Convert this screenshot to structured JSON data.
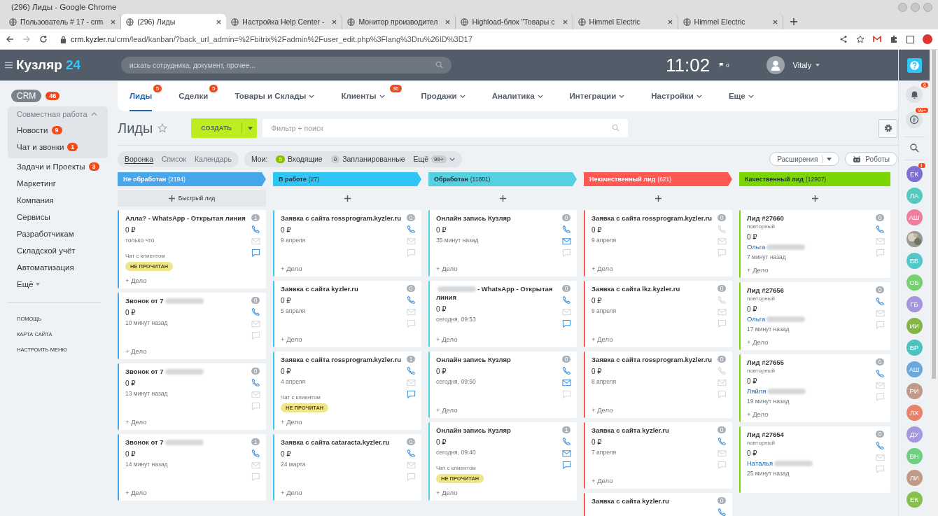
{
  "window": {
    "title": "(296) Лиды - Google Chrome"
  },
  "browser_tabs": [
    {
      "title": "Пользователь # 17 - crm",
      "selected": false
    },
    {
      "title": "(296) Лиды",
      "selected": true
    },
    {
      "title": "Настройка Help Center -",
      "selected": false
    },
    {
      "title": "Монитор производител",
      "selected": false
    },
    {
      "title": "Highload-блок \"Товары с",
      "selected": false
    },
    {
      "title": "Himmel Electric",
      "selected": false
    },
    {
      "title": "Himmel Electric",
      "selected": false
    }
  ],
  "address_bar": {
    "host": "crm.kyzler.ru",
    "path": "/crm/lead/kanban/?back_url_admin=%2Fbitrix%2Fadmin%2Fuser_edit.php%3Flang%3Dru%26ID%3D17"
  },
  "header": {
    "logo": "Кузляр",
    "logo_suffix": "24",
    "search": {
      "placeholder": "искать сотрудника, документ, прочее..."
    },
    "clock": "11:02",
    "flag_count": "0",
    "user": "Vitaly"
  },
  "sidebar": {
    "crm": {
      "label": "CRM",
      "badge": "46"
    },
    "group": {
      "label": "Совместная работа",
      "expanded": true,
      "items": [
        {
          "label": "Новости",
          "badge": "9"
        },
        {
          "label": "Чат и звонки",
          "badge": "1"
        }
      ]
    },
    "items": [
      {
        "label": "Задачи и Проекты",
        "badge": "3"
      },
      {
        "label": "Маркетинг"
      },
      {
        "label": "Компания"
      },
      {
        "label": "Сервисы"
      },
      {
        "label": "Разработчикам"
      },
      {
        "label": "Складской учёт"
      },
      {
        "label": "Автоматизация"
      },
      {
        "label": "Ещё",
        "dropdown": true
      }
    ],
    "links": [
      "ПОМОЩЬ",
      "КАРТА САЙТА",
      "НАСТРОИТЬ МЕНЮ"
    ]
  },
  "nav": [
    {
      "label": "Лиды",
      "badge": "5",
      "dropdown": false,
      "selected": true
    },
    {
      "label": "Сделки",
      "badge": "5",
      "dropdown": false,
      "selected": false
    },
    {
      "label": "Товары и Склады",
      "dropdown": true,
      "selected": false
    },
    {
      "label": "Клиенты",
      "badge": "36",
      "dropdown": true,
      "selected": false
    },
    {
      "label": "Продажи",
      "dropdown": true,
      "selected": false
    },
    {
      "label": "Аналитика",
      "dropdown": true,
      "selected": false
    },
    {
      "label": "Интеграции",
      "dropdown": true,
      "selected": false
    },
    {
      "label": "Настройки",
      "dropdown": true,
      "selected": false
    },
    {
      "label": "Еще",
      "dropdown": true,
      "selected": false
    }
  ],
  "page": {
    "title": "Лиды",
    "create_button": "СОЗДАТЬ",
    "filter": {
      "placeholder": "Фильтр + поиск"
    }
  },
  "toolbar": {
    "views": [
      {
        "label": "Воронка",
        "selected": true
      },
      {
        "label": "Список",
        "selected": false
      },
      {
        "label": "Календарь",
        "selected": false
      }
    ],
    "my_label": "Мои:",
    "counters": [
      {
        "count": "5",
        "label": "Входящие",
        "active": true
      },
      {
        "count": "0",
        "label": "Запланированные",
        "active": false
      }
    ],
    "more": {
      "label": "Ещё",
      "badge": "99+"
    },
    "extensions": "Расширения",
    "robots": "Роботы"
  },
  "columns": [
    {
      "name": "Не обработан",
      "count": "(2194)",
      "color": "#47a7ea",
      "quick_add": "Быстрый лид",
      "cards": [
        {
          "title": "Алла? - WhatsApp - Открытая линия",
          "count": "1",
          "amount": "0 ₽",
          "time": "только что",
          "chat_label": "Чат с клиентом",
          "badge": "НЕ ПРОЧИТАН",
          "phone_active": true,
          "mail_active": false,
          "chat_active": true,
          "add": "+ Дело"
        },
        {
          "title": "Звонок от 7",
          "blurred_suffix": true,
          "count": "0",
          "amount": "0 ₽",
          "time": "10 минут назад",
          "phone_active": true,
          "mail_active": false,
          "chat_active": false,
          "add": "+ Дело"
        },
        {
          "title": "Звонок от 7",
          "blurred_suffix": true,
          "count": "0",
          "amount": "0 ₽",
          "time": "13 минут назад",
          "phone_active": true,
          "mail_active": false,
          "chat_active": false,
          "add": "+ Дело"
        },
        {
          "title": "Звонок от 7",
          "blurred_suffix": true,
          "count": "1",
          "amount": "0 ₽",
          "time": "14 минут назад",
          "phone_active": true,
          "mail_active": false,
          "chat_active": false,
          "add": "+ Дело"
        }
      ]
    },
    {
      "name": "В работе",
      "count": "(27)",
      "color": "#2fc6f6",
      "cards": [
        {
          "title": "Заявка с сайта rossprogram.kyzler.ru",
          "count": "0",
          "amount": "0 ₽",
          "time": "9 апреля",
          "phone_active": true,
          "mail_active": false,
          "chat_active": false,
          "add": "+ Дело"
        },
        {
          "title": "Заявка с сайта kyzler.ru",
          "count": "0",
          "amount": "0 ₽",
          "time": "5 апреля",
          "phone_active": true,
          "mail_active": false,
          "chat_active": false,
          "add": "+ Дело"
        },
        {
          "title": "Заявка с сайта rossprogram.kyzler.ru",
          "count": "1",
          "amount": "0 ₽",
          "time": "4 апреля",
          "chat_label": "Чат с клиентом",
          "badge": "НЕ ПРОЧИТАН",
          "phone_active": true,
          "mail_active": false,
          "chat_active": true,
          "add": "+ Дело"
        },
        {
          "title": "Заявка с сайта cataracta.kyzler.ru",
          "count": "0",
          "amount": "0 ₽",
          "time": "24 марта",
          "phone_active": true,
          "mail_active": false,
          "chat_active": false,
          "add": "+ Дело"
        }
      ]
    },
    {
      "name": "Обработан",
      "count": "(11801)",
      "color": "#55d0e0",
      "cards": [
        {
          "title": "Онлайн запись Кузляр",
          "count": "0",
          "amount": "0 ₽",
          "time": "35 минут назад",
          "phone_active": true,
          "mail_active": true,
          "chat_active": false,
          "add": "+ Дело"
        },
        {
          "title": "- WhatsApp - Открытая линия",
          "blurred_prefix": true,
          "count": "0",
          "amount": "0 ₽",
          "time": "сегодня, 09:53",
          "phone_active": true,
          "mail_active": false,
          "chat_active": true,
          "add": "+ Дело"
        },
        {
          "title": "Онлайн запись Кузляр",
          "count": "0",
          "amount": "0 ₽",
          "time": "сегодня, 09:50",
          "phone_active": true,
          "mail_active": true,
          "chat_active": false,
          "add": "+ Дело"
        },
        {
          "title": "Онлайн запись Кузляр",
          "count": "1",
          "amount": "0 ₽",
          "time": "сегодня, 09:40",
          "chat_label": "Чат с клиентом",
          "badge": "НЕ ПРОЧИТАН",
          "phone_active": true,
          "mail_active": true,
          "chat_active": true,
          "add": "+ Дело"
        }
      ]
    },
    {
      "name": "Некачественный лид",
      "count": "(621)",
      "color": "#ff5752",
      "cards": [
        {
          "title": "Заявка с сайта rossprogram.kyzler.ru",
          "count": "0",
          "amount": "0 ₽",
          "time": "9 апреля",
          "phone_active": false,
          "mail_active": false,
          "chat_active": false,
          "add": "+ Дело"
        },
        {
          "title": "Заявка с сайта lkz.kyzler.ru",
          "count": "0",
          "amount": "0 ₽",
          "time": "9 апреля",
          "phone_active": false,
          "mail_active": false,
          "chat_active": false,
          "add": "+ Дело"
        },
        {
          "title": "Заявка с сайта rossprogram.kyzler.ru",
          "count": "0",
          "amount": "0 ₽",
          "time": "8 апреля",
          "phone_active": false,
          "mail_active": false,
          "chat_active": false,
          "add": "+ Дело"
        },
        {
          "title": "Заявка с сайта kyzler.ru",
          "count": "0",
          "amount": "0 ₽",
          "time": "7 апреля",
          "phone_active": true,
          "mail_active": false,
          "chat_active": false,
          "add": "+ Дело"
        },
        {
          "title": "Заявка с сайта kyzler.ru",
          "count": "0",
          "phone_active": true
        }
      ]
    },
    {
      "name": "Качественный лид",
      "count": "(12907)",
      "color": "#7bd500",
      "cards": [
        {
          "title": "Лид #27660",
          "subtitle": "повторный",
          "count": "0",
          "amount": "0 ₽",
          "contact": "Ольга",
          "time": "7 минут назад",
          "phone_active": true,
          "mail_active": false,
          "chat_active": false,
          "add": "+ Дело"
        },
        {
          "title": "Лид #27656",
          "subtitle": "повторный",
          "count": "0",
          "amount": "0 ₽",
          "contact": "Ольга",
          "time": "17 минут назад",
          "phone_active": true,
          "mail_active": false,
          "chat_active": false,
          "add": "+ Дело"
        },
        {
          "title": "Лид #27655",
          "subtitle": "повторный",
          "count": "0",
          "amount": "0 ₽",
          "contact": "Ляйля",
          "time": "19 минут назад",
          "phone_active": true,
          "mail_active": false,
          "chat_active": false,
          "add": "+ Дело"
        },
        {
          "title": "Лид #27654",
          "subtitle": "повторный",
          "count": "0",
          "amount": "0 ₽",
          "contact": "Наталья",
          "time": "25 минут назад",
          "phone_active": true,
          "mail_active": false,
          "chat_active": false
        }
      ]
    }
  ],
  "right_panel": {
    "notifications_badge": "6",
    "chats_badge": "99+",
    "avatars": [
      {
        "initials": "ЕК",
        "color": "#7e6fd0",
        "badge": "1"
      },
      {
        "initials": "ЛА",
        "color": "#55c9c0"
      },
      {
        "initials": "АШ",
        "color": "#f07ca0"
      },
      {
        "kind": "photo",
        "color": "#9a9a94"
      },
      {
        "initials": "ВБ",
        "color": "#4fc8c8"
      },
      {
        "initials": "ОБ",
        "color": "#77cf72"
      },
      {
        "initials": "ГБ",
        "color": "#a595dd"
      },
      {
        "initials": "ИИ",
        "color": "#85b545"
      },
      {
        "initials": "ВР",
        "color": "#4bc4c0"
      },
      {
        "initials": "АШ",
        "color": "#6aa9dd"
      },
      {
        "initials": "РИ",
        "color": "#c09a88"
      },
      {
        "initials": "ЛХ",
        "color": "#e8836a"
      },
      {
        "initials": "ДУ",
        "color": "#a497de"
      },
      {
        "initials": "ВН",
        "color": "#6fcf80"
      },
      {
        "initials": "ЛИ",
        "color": "#c29a8a"
      },
      {
        "initials": "ЕК",
        "color": "#88c04f"
      }
    ]
  }
}
